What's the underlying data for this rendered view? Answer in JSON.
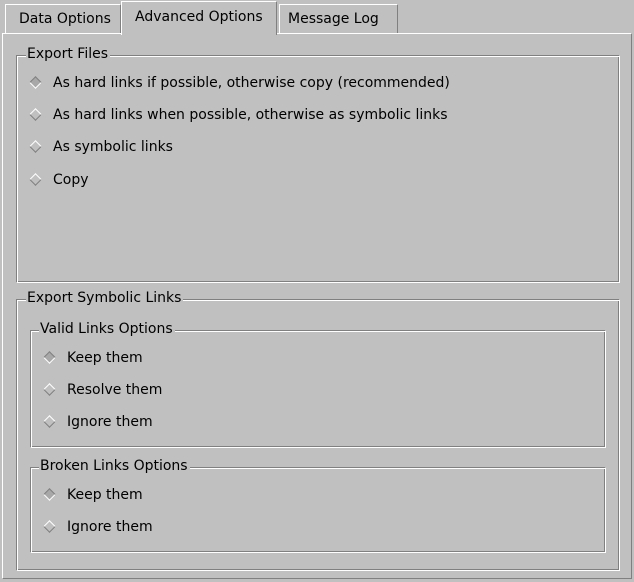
{
  "tabs": [
    {
      "label": "Data Options",
      "active": false
    },
    {
      "label": "Advanced Options",
      "active": true
    },
    {
      "label": "Message Log",
      "active": false
    }
  ],
  "export_files": {
    "title": "Export Files",
    "selected": 0,
    "options": [
      "As hard links if possible, otherwise copy (recommended)",
      "As hard links when possible, otherwise as symbolic links",
      "As symbolic links",
      "Copy"
    ]
  },
  "export_symbolic_links": {
    "title": "Export Symbolic Links",
    "valid_links": {
      "title": "Valid Links Options",
      "selected": 0,
      "options": [
        "Keep them",
        "Resolve them",
        "Ignore them"
      ]
    },
    "broken_links": {
      "title": "Broken Links Options",
      "selected": 0,
      "options": [
        "Keep them",
        "Ignore them"
      ]
    }
  },
  "colors": {
    "background": "#c0c0c0",
    "highlight": "#ffffff",
    "shadow": "#808080",
    "selected_indicator": "#a8a8a8"
  }
}
